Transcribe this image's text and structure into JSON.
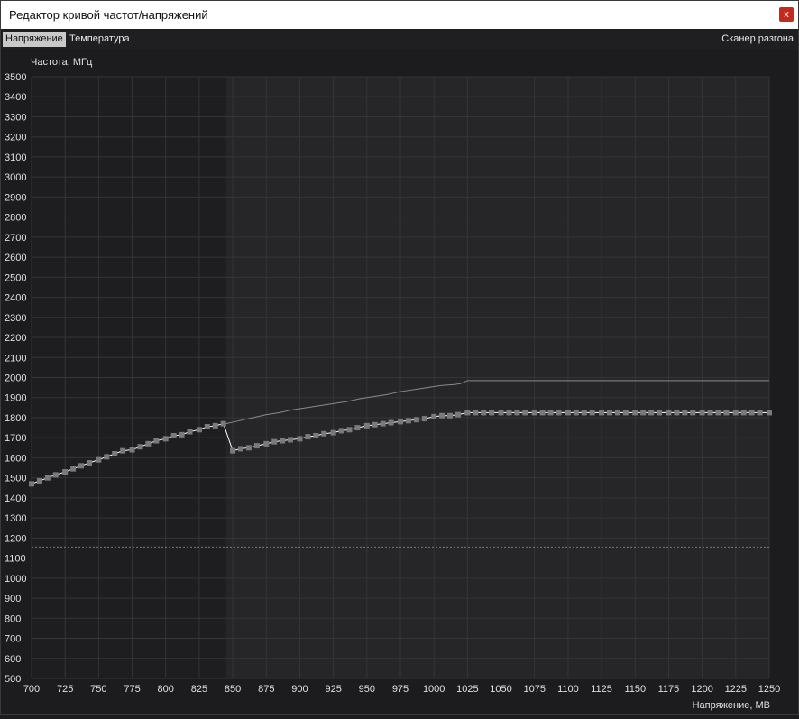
{
  "window": {
    "title": "Редактор кривой частот/напряжений",
    "close_label": "x"
  },
  "tabs": {
    "voltage": "Напряжение",
    "temperature": "Температура",
    "scanner": "Сканер разгона"
  },
  "colors": {
    "plot_bg": "#262629",
    "plot_bg_locked": "#1e1e20",
    "grid": "#34343a",
    "axis_text": "#e0e0e0",
    "curve": "#ffffff",
    "point": "#7a7a7a",
    "target_line": "#8a8a8a",
    "reference_line": "#7a7a7a",
    "close_button": "#c42b1c"
  },
  "chart_data": {
    "type": "line",
    "ylabel": "Частота, МГц",
    "xlabel": "Напряжение, МВ",
    "xlim": [
      700,
      1250
    ],
    "ylim": [
      500,
      3500
    ],
    "x_ticks": [
      700,
      725,
      750,
      775,
      800,
      825,
      850,
      875,
      900,
      925,
      950,
      975,
      1000,
      1025,
      1050,
      1075,
      1100,
      1125,
      1150,
      1175,
      1200,
      1225,
      1250
    ],
    "y_ticks": [
      500,
      600,
      700,
      800,
      900,
      1000,
      1100,
      1200,
      1300,
      1400,
      1500,
      1600,
      1700,
      1800,
      1900,
      2000,
      2100,
      2200,
      2300,
      2400,
      2500,
      2600,
      2700,
      2800,
      2900,
      3000,
      3100,
      3200,
      3300,
      3400,
      3500
    ],
    "locked_region_end_x": 845,
    "reference_frequency": 1155,
    "series": [
      {
        "role": "current_curve",
        "x": [
          700,
          706,
          712,
          718,
          725,
          731,
          737,
          743,
          750,
          756,
          762,
          768,
          775,
          781,
          787,
          793,
          800,
          806,
          812,
          818,
          825,
          831,
          837,
          843,
          850,
          856,
          862,
          868,
          875,
          881,
          887,
          893,
          900,
          906,
          912,
          918,
          925,
          931,
          937,
          943,
          950,
          956,
          962,
          968,
          975,
          981,
          987,
          993,
          1000,
          1006,
          1012,
          1018,
          1025,
          1031,
          1037,
          1043,
          1050,
          1056,
          1062,
          1068,
          1075,
          1081,
          1087,
          1093,
          1100,
          1106,
          1112,
          1118,
          1125,
          1131,
          1137,
          1143,
          1150,
          1156,
          1162,
          1168,
          1175,
          1181,
          1187,
          1193,
          1200,
          1206,
          1212,
          1218,
          1225,
          1231,
          1237,
          1243,
          1250
        ],
        "y": [
          1470,
          1485,
          1500,
          1515,
          1530,
          1545,
          1560,
          1575,
          1590,
          1605,
          1620,
          1635,
          1640,
          1655,
          1670,
          1685,
          1695,
          1710,
          1715,
          1730,
          1740,
          1755,
          1760,
          1770,
          1635,
          1645,
          1650,
          1660,
          1670,
          1680,
          1685,
          1690,
          1695,
          1705,
          1710,
          1720,
          1725,
          1735,
          1740,
          1750,
          1760,
          1765,
          1770,
          1775,
          1780,
          1785,
          1790,
          1795,
          1805,
          1810,
          1810,
          1815,
          1825,
          1825,
          1825,
          1825,
          1825,
          1825,
          1825,
          1825,
          1825,
          1825,
          1825,
          1825,
          1825,
          1825,
          1825,
          1825,
          1825,
          1825,
          1825,
          1825,
          1825,
          1825,
          1825,
          1825,
          1825,
          1825,
          1825,
          1825,
          1825,
          1825,
          1825,
          1825,
          1825,
          1825,
          1825,
          1825,
          1825
        ]
      },
      {
        "role": "target_curve",
        "x": [
          845,
          855,
          865,
          875,
          885,
          895,
          905,
          915,
          925,
          935,
          945,
          955,
          965,
          975,
          985,
          995,
          1005,
          1015,
          1020,
          1025,
          1250
        ],
        "y": [
          1770,
          1785,
          1800,
          1815,
          1825,
          1840,
          1850,
          1860,
          1870,
          1880,
          1895,
          1905,
          1915,
          1930,
          1940,
          1950,
          1960,
          1965,
          1970,
          1985,
          1985
        ]
      }
    ]
  }
}
